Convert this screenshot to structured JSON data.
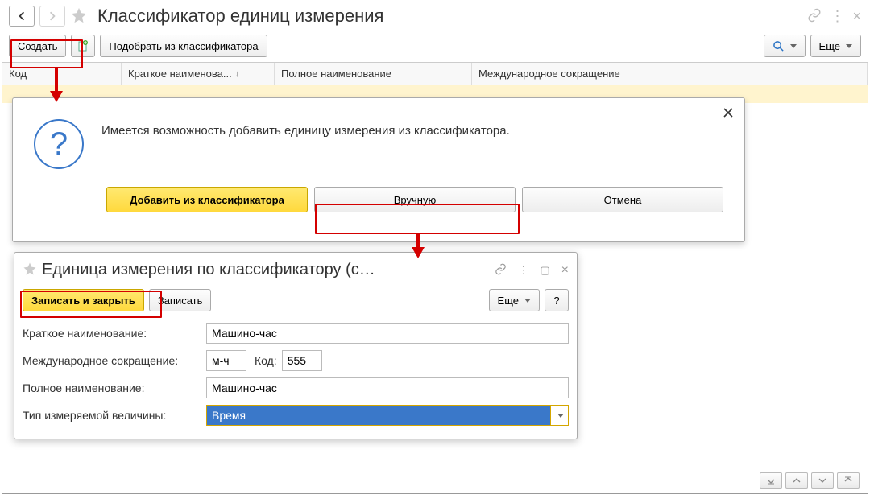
{
  "title": "Классификатор единиц измерения",
  "toolbar": {
    "create": "Создать",
    "pick": "Подобрать из классификатора",
    "more": "Еще"
  },
  "grid": {
    "columns": {
      "code": "Код",
      "short": "Краткое наименова...",
      "full": "Полное наименование",
      "intl": "Международное сокращение"
    }
  },
  "dialog1": {
    "text": "Имеется возможность добавить единицу измерения из классификатора.",
    "btn_add": "Добавить из классификатора",
    "btn_manual": "Вручную",
    "btn_cancel": "Отмена"
  },
  "dialog2": {
    "title": "Единица измерения по классификатору (с…",
    "save_close": "Записать и закрыть",
    "save": "Записать",
    "more": "Еще",
    "help": "?",
    "labels": {
      "short": "Краткое наименование:",
      "intl": "Международное сокращение:",
      "code": "Код:",
      "full": "Полное наименование:",
      "type": "Тип измеряемой величины:"
    },
    "values": {
      "short": "Машино-час",
      "intl": "м-ч",
      "code": "555",
      "full": "Машино-час",
      "type": "Время"
    }
  }
}
